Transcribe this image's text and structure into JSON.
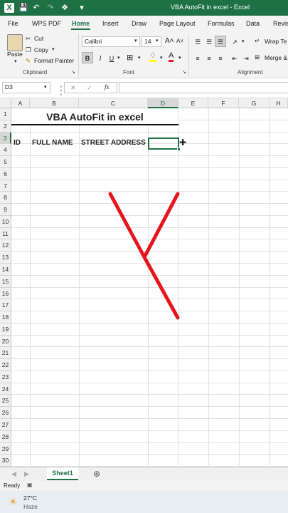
{
  "window": {
    "title": "VBA AutoFit in excel  -  Excel"
  },
  "menu": {
    "items": [
      "File",
      "WPS PDF",
      "Home",
      "Insert",
      "Draw",
      "Page Layout",
      "Formulas",
      "Data",
      "Revie"
    ],
    "active": "Home"
  },
  "ribbon": {
    "clipboard": {
      "paste": "Paste",
      "cut": "Cut",
      "copy": "Copy",
      "format_painter": "Format Painter",
      "group": "Clipboard"
    },
    "font": {
      "name": "Calibri",
      "size": "14",
      "bold": "B",
      "italic": "I",
      "underline": "U",
      "grow": "A˄",
      "shrink": "A˅",
      "group": "Font"
    },
    "alignment": {
      "wrap": "Wrap Te",
      "merge": "Merge &",
      "group": "Alignment"
    }
  },
  "formula_bar": {
    "name_box": "D3",
    "cancel": "✕",
    "enter": "✓",
    "fx": "fx",
    "value": ""
  },
  "columns": [
    "A",
    "B",
    "C",
    "D",
    "E",
    "F",
    "G",
    "H"
  ],
  "selected": {
    "column": "D",
    "row": "3"
  },
  "rows": [
    "1",
    "2",
    "3",
    "4",
    "5",
    "6",
    "7",
    "8",
    "9",
    "10",
    "11",
    "12",
    "13",
    "14",
    "15",
    "16",
    "17",
    "18",
    "19",
    "20",
    "21",
    "22",
    "23",
    "24",
    "25",
    "26",
    "27",
    "28",
    "29",
    "30"
  ],
  "cells": {
    "title": "VBA AutoFit in excel",
    "a3": "ID",
    "b3": "FULL NAME",
    "c3": "STREET ADDRESS"
  },
  "annotation_color": "#e8141c",
  "sheets": {
    "active": "Sheet1",
    "add": "⊕"
  },
  "status": {
    "ready": "Ready"
  },
  "taskbar": {
    "temp": "27°C",
    "weather": "Haze"
  }
}
